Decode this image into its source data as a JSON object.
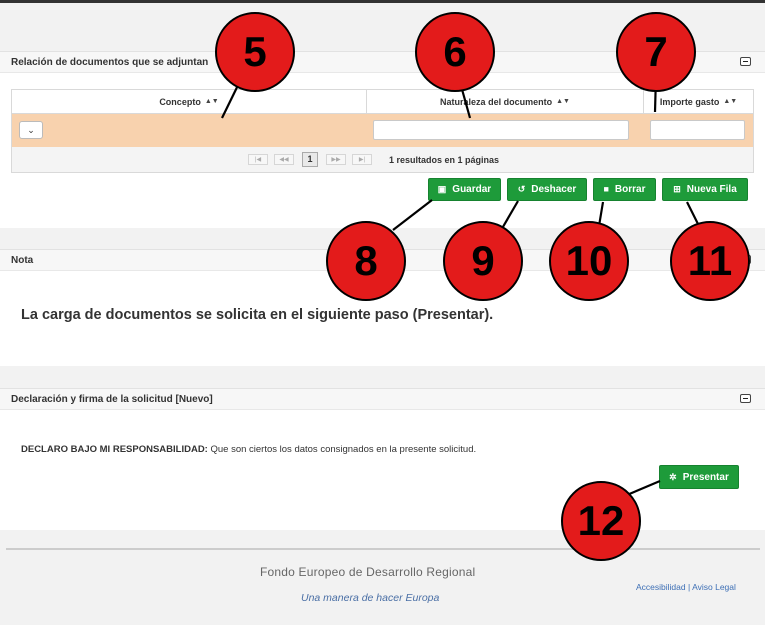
{
  "panels": {
    "documents": {
      "title": "Relación de documentos que se adjuntan",
      "columns": [
        "Concepto",
        "Naturaleza del documento",
        "Importe gasto"
      ],
      "select_symbol": "⌄",
      "pager": {
        "current_page": "1",
        "info": "1 resultados en 1 páginas"
      },
      "buttons": {
        "save": "Guardar",
        "undo": "Deshacer",
        "delete": "Borrar",
        "new_row": "Nueva Fila"
      }
    },
    "note": {
      "title": "Nota",
      "text": "La carga de documentos se solicita en el siguiente paso (Presentar)."
    },
    "declaration": {
      "title": "Declaración y firma de la solicitud [Nuevo]",
      "label": "DECLARO BAJO MI RESPONSABILIDAD:",
      "text": " Que son ciertos los datos consignados en la presente solicitud.",
      "submit": "Presentar"
    }
  },
  "markers": [
    "5",
    "6",
    "7",
    "8",
    "9",
    "10",
    "11",
    "12"
  ],
  "footer": {
    "fund": "Fondo Europeo de Desarrollo Regional",
    "motto": "Una manera de hacer Europa",
    "links": [
      "Accesibilidad",
      "Aviso Legal"
    ],
    "link_separator": " | "
  },
  "colors": {
    "accent_green": "#1e9b3a",
    "row_highlight": "#f8d2ae",
    "marker_red": "#e31b1b"
  }
}
